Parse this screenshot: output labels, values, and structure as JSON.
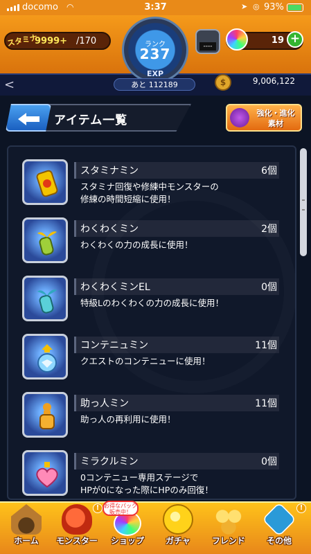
{
  "status_bar": {
    "carrier": "docomo",
    "time": "3:37",
    "battery": "93%",
    "battery_level": 0.93
  },
  "header": {
    "stamina_label": "スタミナ",
    "stamina_value": "9999+",
    "stamina_max": "/170",
    "rank_label": "ランク",
    "rank_value": "237",
    "exp_label": "EXP",
    "exp_remaining": "あと 112189",
    "device_text": "----",
    "gems": "19",
    "coins": "9,006,122"
  },
  "title": {
    "text": "アイテム一覧",
    "evolve_button": "強化・進化\n素材"
  },
  "items": [
    {
      "name": "スタミナミン",
      "count": "6個",
      "desc": "スタミナ回復や修練中モンスターの\n修練の時間短縮に使用！",
      "icon": "can-icon"
    },
    {
      "name": "わくわくミン",
      "count": "2個",
      "desc": "わくわくの力の成長に使用！",
      "icon": "sprout-bottle-icon"
    },
    {
      "name": "わくわくミンEL",
      "count": "0個",
      "desc": "特級Lのわくわくの力の成長に使用！",
      "icon": "sprout-bottle-el-icon"
    },
    {
      "name": "コンテニュミン",
      "count": "11個",
      "desc": "クエストのコンテニューに使用！",
      "icon": "potion-flask-icon"
    },
    {
      "name": "助っ人ミン",
      "count": "11個",
      "desc": "助っ人の再利用に使用！",
      "icon": "helper-bottle-icon"
    },
    {
      "name": "ミラクルミン",
      "count": "0個",
      "desc": "0コンテニュー専用ステージで\nHPが0になった際にHPのみ回復！",
      "icon": "heart-bottle-icon"
    }
  ],
  "scroll_position": 0.0,
  "nav": {
    "items": [
      {
        "label": "ホーム",
        "icon": "home-icon"
      },
      {
        "label": "モンスター",
        "icon": "monster-icon"
      },
      {
        "label": "ショップ",
        "icon": "shop-icon"
      },
      {
        "label": "ガチャ",
        "icon": "gacha-icon"
      },
      {
        "label": "フレンド",
        "icon": "friend-icon"
      },
      {
        "label": "その他",
        "icon": "other-icon"
      }
    ],
    "shop_badge": "お得なパック\n販売中！",
    "alert_mark": "!"
  },
  "colors": {
    "accent_orange": "#e98a18",
    "panel_dark": "#10182a",
    "item_blue": "#2b4a9a"
  }
}
